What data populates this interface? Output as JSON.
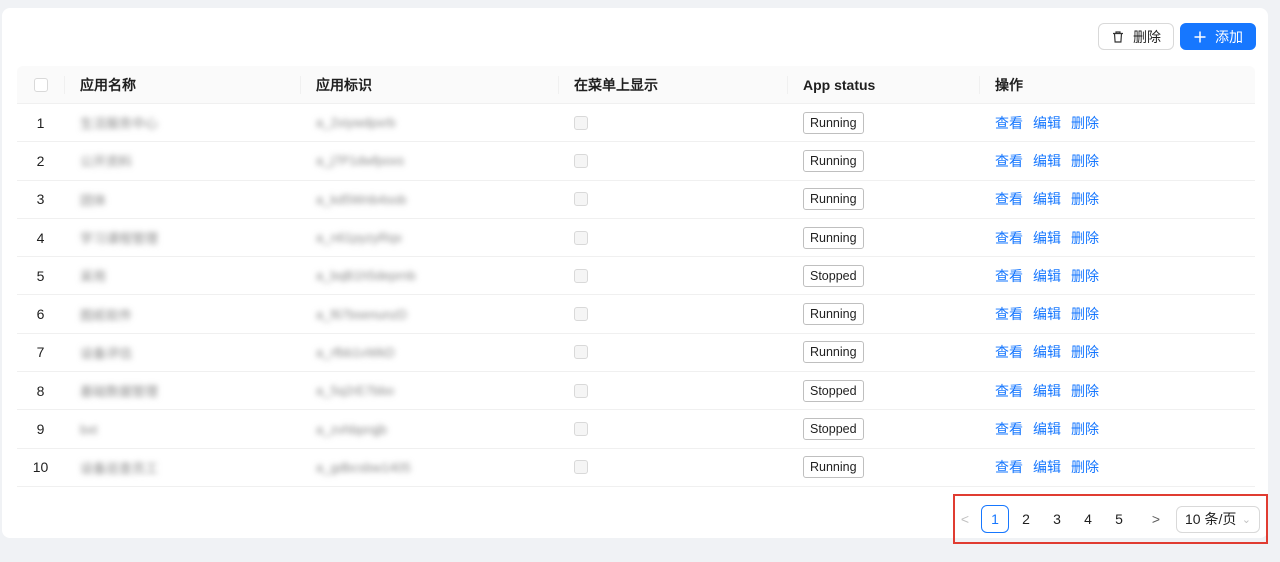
{
  "toolbar": {
    "delete_label": "删除",
    "add_label": "添加"
  },
  "table": {
    "headers": {
      "name": "应用名称",
      "key": "应用标识",
      "menu": "在菜单上显示",
      "status": "App status",
      "ops": "操作"
    },
    "rows": [
      {
        "idx": "1",
        "name": "生活服务中心",
        "key": "a_2xiywdpxrb",
        "status": "Running"
      },
      {
        "idx": "2",
        "name": "公开资料",
        "key": "a_j7P1dwfpoxs",
        "status": "Running"
      },
      {
        "idx": "3",
        "name": "团体",
        "key": "a_kd5Wnb4sob",
        "status": "Running"
      },
      {
        "idx": "4",
        "name": "学习课程管理",
        "key": "a_n61pyzyRqx",
        "status": "Running"
      },
      {
        "idx": "5",
        "name": "采用",
        "key": "a_bqB1h5deprnb",
        "status": "Stopped"
      },
      {
        "idx": "6",
        "name": "图纸软件",
        "key": "a_f67bsenunzD",
        "status": "Running"
      },
      {
        "idx": "7",
        "name": "设备评估",
        "key": "a_rfbb1vWkD",
        "status": "Running"
      },
      {
        "idx": "8",
        "name": "基础数据管理",
        "key": "a_5q2rE7bbo",
        "status": "Stopped"
      },
      {
        "idx": "9",
        "name": "bxt",
        "key": "a_zvhbprqjb",
        "status": "Stopped"
      },
      {
        "idx": "10",
        "name": "设备巡查员工",
        "key": "a_gdbcsbw1405",
        "status": "Running"
      }
    ],
    "actions": {
      "view": "查看",
      "edit": "编辑",
      "delete": "删除"
    }
  },
  "pagination": {
    "prev": "<",
    "next": ">",
    "pages": [
      "1",
      "2",
      "3",
      "4",
      "5"
    ],
    "current": "1",
    "page_size": "10 条/页"
  },
  "colors": {
    "primary": "#1677ff",
    "highlight_box": "#e03c31"
  }
}
